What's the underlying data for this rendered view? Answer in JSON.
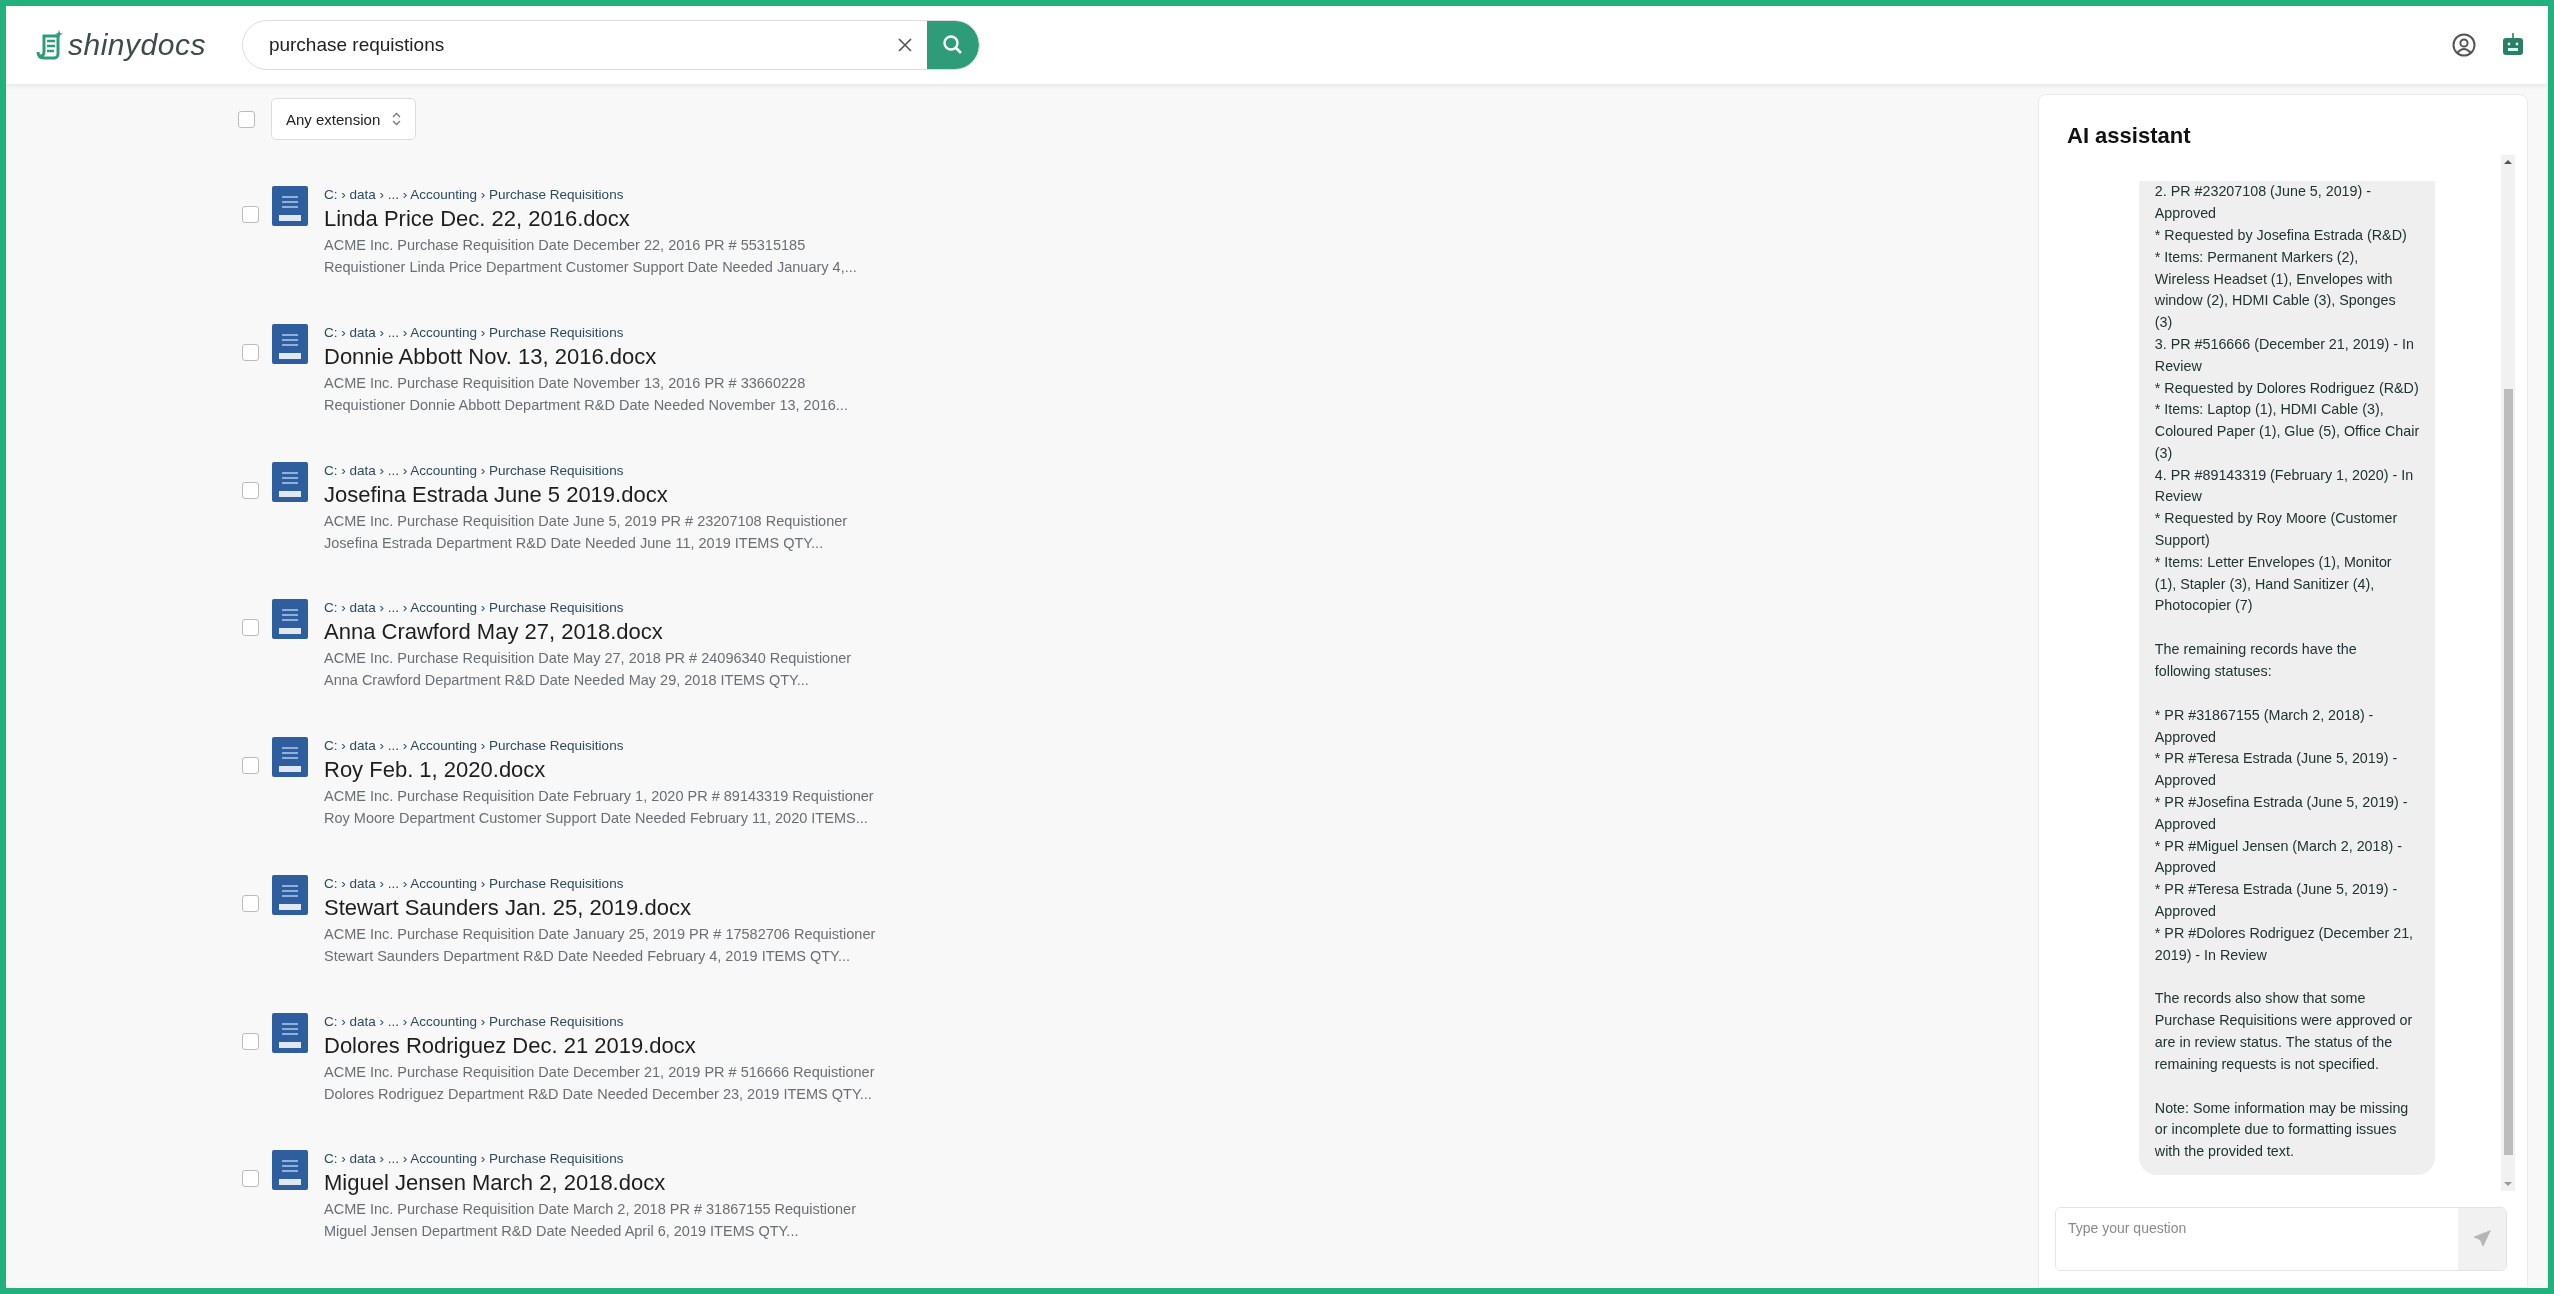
{
  "header": {
    "logo": "shinydocs",
    "search": {
      "value": "purchase requistions"
    }
  },
  "filters": {
    "select_all": {
      "checked": false
    },
    "extension": "Any extension"
  },
  "results": [
    {
      "path": "C: › data › ... › Accounting › Purchase Requisitions",
      "title": "Linda Price Dec. 22, 2016.docx",
      "snippet": [
        "ACME Inc. Purchase Requisition Date December 22, 2016 PR # 55315185",
        "Requistioner Linda Price Department Customer Support Date Needed January 4,..."
      ],
      "checked": false
    },
    {
      "path": "C: › data › ... › Accounting › Purchase Requisitions",
      "title": "Donnie Abbott Nov. 13, 2016.docx",
      "snippet": [
        "ACME Inc. Purchase Requisition Date November 13, 2016 PR # 33660228",
        "Requistioner Donnie Abbott Department R&D Date Needed November 13, 2016..."
      ],
      "checked": false
    },
    {
      "path": "C: › data › ... › Accounting › Purchase Requisitions",
      "title": "Josefina Estrada June 5 2019.docx",
      "snippet": [
        "ACME Inc. Purchase Requisition Date June 5, 2019 PR # 23207108 Requistioner",
        "Josefina Estrada Department R&D Date Needed June 11, 2019 ITEMS QTY..."
      ],
      "checked": false
    },
    {
      "path": "C: › data › ... › Accounting › Purchase Requisitions",
      "title": "Anna Crawford May 27, 2018.docx",
      "snippet": [
        "ACME Inc. Purchase Requisition Date May 27, 2018 PR # 24096340 Requistioner",
        "Anna Crawford Department R&D Date Needed May 29, 2018 ITEMS QTY..."
      ],
      "checked": false
    },
    {
      "path": "C: › data › ... › Accounting › Purchase Requisitions",
      "title": "Roy Feb. 1, 2020.docx",
      "snippet": [
        "ACME Inc. Purchase Requisition Date February 1, 2020 PR # 89143319 Requistioner",
        "Roy Moore Department Customer Support Date Needed February 11, 2020 ITEMS..."
      ],
      "checked": false
    },
    {
      "path": "C: › data › ... › Accounting › Purchase Requisitions",
      "title": "Stewart Saunders Jan. 25, 2019.docx",
      "snippet": [
        "ACME Inc. Purchase Requisition Date January 25, 2019 PR # 17582706 Requistioner",
        "Stewart Saunders Department R&D Date Needed February 4, 2019 ITEMS QTY..."
      ],
      "checked": false
    },
    {
      "path": "C: › data › ... › Accounting › Purchase Requisitions",
      "title": "Dolores Rodriguez Dec. 21 2019.docx",
      "snippet": [
        "ACME Inc. Purchase Requisition Date December 21, 2019 PR # 516666 Requistioner",
        "Dolores Rodriguez Department R&D Date Needed December 23, 2019 ITEMS QTY..."
      ],
      "checked": false
    },
    {
      "path": "C: › data › ... › Accounting › Purchase Requisitions",
      "title": "Miguel Jensen March 2, 2018.docx",
      "snippet": [
        "ACME Inc. Purchase Requisition Date March 2, 2018 PR # 31867155 Requistioner",
        "Miguel Jensen Department R&D Date Needed April 6, 2019 ITEMS QTY..."
      ],
      "checked": false
    }
  ],
  "assistant": {
    "title": "AI assistant",
    "message": [
      [
        "2. PR #23207108 (June 5, 2019) -",
        "Approved",
        "* Requested by Josefina Estrada (R&D)",
        "* Items: Permanent Markers (2),",
        "Wireless Headset (1), Envelopes with",
        "window (2), HDMI Cable (3), Sponges",
        "(3)",
        "3. PR #516666 (December 21, 2019) - In",
        "Review",
        "* Requested by Dolores Rodriguez (R&D)",
        "* Items: Laptop (1), HDMI Cable (3),",
        "Coloured Paper (1), Glue (5), Office Chair",
        "(3)",
        "4. PR #89143319 (February 1, 2020) - In",
        "Review",
        "* Requested by Roy Moore (Customer",
        "Support)",
        "* Items: Letter Envelopes (1), Monitor",
        "(1), Stapler (3), Hand Sanitizer (4),",
        "Photocopier (7)"
      ],
      [
        "The remaining records have the",
        "following statuses:"
      ],
      [
        "* PR #31867155 (March 2, 2018) -",
        "Approved",
        "* PR #Teresa Estrada (June 5, 2019) -",
        "Approved",
        "* PR #Josefina Estrada (June 5, 2019) -",
        "Approved",
        "* PR #Miguel Jensen (March 2, 2018) -",
        "Approved",
        "* PR #Teresa Estrada (June 5, 2019) -",
        "Approved",
        "* PR #Dolores Rodriguez (December 21,",
        "2019) - In Review"
      ],
      [
        "The records also show that some",
        "Purchase Requisitions were approved or",
        "are in review status. The status of the",
        "remaining requests is not specified."
      ],
      [
        "Note: Some information may be missing",
        "or incomplete due to formatting issues",
        "with the provided text."
      ]
    ],
    "input": {
      "placeholder": "Type your question"
    }
  }
}
